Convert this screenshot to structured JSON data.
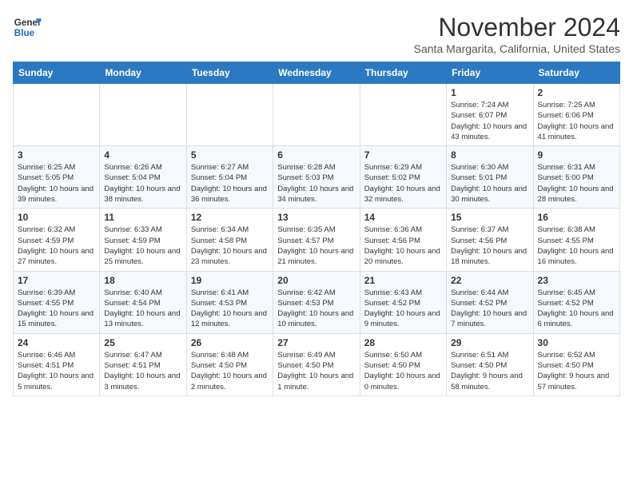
{
  "logo": {
    "line1": "General",
    "line2": "Blue"
  },
  "title": "November 2024",
  "location": "Santa Margarita, California, United States",
  "weekdays": [
    "Sunday",
    "Monday",
    "Tuesday",
    "Wednesday",
    "Thursday",
    "Friday",
    "Saturday"
  ],
  "weeks": [
    [
      {
        "day": "",
        "info": ""
      },
      {
        "day": "",
        "info": ""
      },
      {
        "day": "",
        "info": ""
      },
      {
        "day": "",
        "info": ""
      },
      {
        "day": "",
        "info": ""
      },
      {
        "day": "1",
        "info": "Sunrise: 7:24 AM\nSunset: 6:07 PM\nDaylight: 10 hours and 43 minutes."
      },
      {
        "day": "2",
        "info": "Sunrise: 7:25 AM\nSunset: 6:06 PM\nDaylight: 10 hours and 41 minutes."
      }
    ],
    [
      {
        "day": "3",
        "info": "Sunrise: 6:25 AM\nSunset: 5:05 PM\nDaylight: 10 hours and 39 minutes."
      },
      {
        "day": "4",
        "info": "Sunrise: 6:26 AM\nSunset: 5:04 PM\nDaylight: 10 hours and 38 minutes."
      },
      {
        "day": "5",
        "info": "Sunrise: 6:27 AM\nSunset: 5:04 PM\nDaylight: 10 hours and 36 minutes."
      },
      {
        "day": "6",
        "info": "Sunrise: 6:28 AM\nSunset: 5:03 PM\nDaylight: 10 hours and 34 minutes."
      },
      {
        "day": "7",
        "info": "Sunrise: 6:29 AM\nSunset: 5:02 PM\nDaylight: 10 hours and 32 minutes."
      },
      {
        "day": "8",
        "info": "Sunrise: 6:30 AM\nSunset: 5:01 PM\nDaylight: 10 hours and 30 minutes."
      },
      {
        "day": "9",
        "info": "Sunrise: 6:31 AM\nSunset: 5:00 PM\nDaylight: 10 hours and 28 minutes."
      }
    ],
    [
      {
        "day": "10",
        "info": "Sunrise: 6:32 AM\nSunset: 4:59 PM\nDaylight: 10 hours and 27 minutes."
      },
      {
        "day": "11",
        "info": "Sunrise: 6:33 AM\nSunset: 4:59 PM\nDaylight: 10 hours and 25 minutes."
      },
      {
        "day": "12",
        "info": "Sunrise: 6:34 AM\nSunset: 4:58 PM\nDaylight: 10 hours and 23 minutes."
      },
      {
        "day": "13",
        "info": "Sunrise: 6:35 AM\nSunset: 4:57 PM\nDaylight: 10 hours and 21 minutes."
      },
      {
        "day": "14",
        "info": "Sunrise: 6:36 AM\nSunset: 4:56 PM\nDaylight: 10 hours and 20 minutes."
      },
      {
        "day": "15",
        "info": "Sunrise: 6:37 AM\nSunset: 4:56 PM\nDaylight: 10 hours and 18 minutes."
      },
      {
        "day": "16",
        "info": "Sunrise: 6:38 AM\nSunset: 4:55 PM\nDaylight: 10 hours and 16 minutes."
      }
    ],
    [
      {
        "day": "17",
        "info": "Sunrise: 6:39 AM\nSunset: 4:55 PM\nDaylight: 10 hours and 15 minutes."
      },
      {
        "day": "18",
        "info": "Sunrise: 6:40 AM\nSunset: 4:54 PM\nDaylight: 10 hours and 13 minutes."
      },
      {
        "day": "19",
        "info": "Sunrise: 6:41 AM\nSunset: 4:53 PM\nDaylight: 10 hours and 12 minutes."
      },
      {
        "day": "20",
        "info": "Sunrise: 6:42 AM\nSunset: 4:53 PM\nDaylight: 10 hours and 10 minutes."
      },
      {
        "day": "21",
        "info": "Sunrise: 6:43 AM\nSunset: 4:52 PM\nDaylight: 10 hours and 9 minutes."
      },
      {
        "day": "22",
        "info": "Sunrise: 6:44 AM\nSunset: 4:52 PM\nDaylight: 10 hours and 7 minutes."
      },
      {
        "day": "23",
        "info": "Sunrise: 6:45 AM\nSunset: 4:52 PM\nDaylight: 10 hours and 6 minutes."
      }
    ],
    [
      {
        "day": "24",
        "info": "Sunrise: 6:46 AM\nSunset: 4:51 PM\nDaylight: 10 hours and 5 minutes."
      },
      {
        "day": "25",
        "info": "Sunrise: 6:47 AM\nSunset: 4:51 PM\nDaylight: 10 hours and 3 minutes."
      },
      {
        "day": "26",
        "info": "Sunrise: 6:48 AM\nSunset: 4:50 PM\nDaylight: 10 hours and 2 minutes."
      },
      {
        "day": "27",
        "info": "Sunrise: 6:49 AM\nSunset: 4:50 PM\nDaylight: 10 hours and 1 minute."
      },
      {
        "day": "28",
        "info": "Sunrise: 6:50 AM\nSunset: 4:50 PM\nDaylight: 10 hours and 0 minutes."
      },
      {
        "day": "29",
        "info": "Sunrise: 6:51 AM\nSunset: 4:50 PM\nDaylight: 9 hours and 58 minutes."
      },
      {
        "day": "30",
        "info": "Sunrise: 6:52 AM\nSunset: 4:50 PM\nDaylight: 9 hours and 57 minutes."
      }
    ]
  ]
}
